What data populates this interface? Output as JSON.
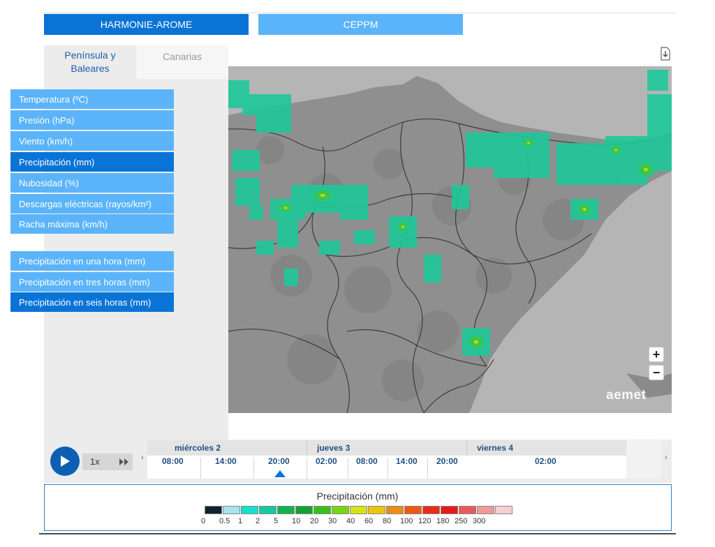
{
  "models": {
    "harmonie": "HARMONIE-AROME",
    "ceppm": "CEPPM"
  },
  "regions": {
    "peninsula": "Península y Baleares",
    "canarias": "Canarias"
  },
  "variables": [
    "Temperatura (ºC)",
    "Presión (hPa)",
    "Viento (km/h)",
    "Precipitación (mm)",
    "Nubosidad (%)",
    "Descargas eléctricas (rayos/km²)",
    "Racha máxima (km/h)"
  ],
  "precip_variables": [
    "Precipitación en una hora (mm)",
    "Precipitación en tres horas (mm)",
    "Precipitación en seis horas (mm)"
  ],
  "map": {
    "watermark": "aemet",
    "zoom_in": "+",
    "zoom_out": "−"
  },
  "player": {
    "speed": "1x"
  },
  "timeline": {
    "left_arrow": "‹",
    "right_arrow": "›",
    "days": [
      "miércoles 2",
      "jueves 3",
      "viernes 4"
    ],
    "hours": [
      "08:00",
      "14:00",
      "20:00",
      "02:00",
      "08:00",
      "14:00",
      "20:00",
      "02:00"
    ],
    "selected": "20:00"
  },
  "legend": {
    "title": "Precipitación (mm)",
    "ticks": [
      "0",
      "0.5",
      "1",
      "2",
      "5",
      "10",
      "20",
      "30",
      "40",
      "60",
      "80",
      "100",
      "120",
      "180",
      "250",
      "300"
    ],
    "colors": [
      "#0d2430",
      "#a6e4ea",
      "#15e0cc",
      "#17c8a0",
      "#10b350",
      "#12a232",
      "#39c018",
      "#7ad414",
      "#d6e417",
      "#ecc60e",
      "#ec8c12",
      "#ec5a12",
      "#e92b14",
      "#e71a1a",
      "#e65a5a",
      "#ef9a9a",
      "#f7cfcf"
    ]
  }
}
